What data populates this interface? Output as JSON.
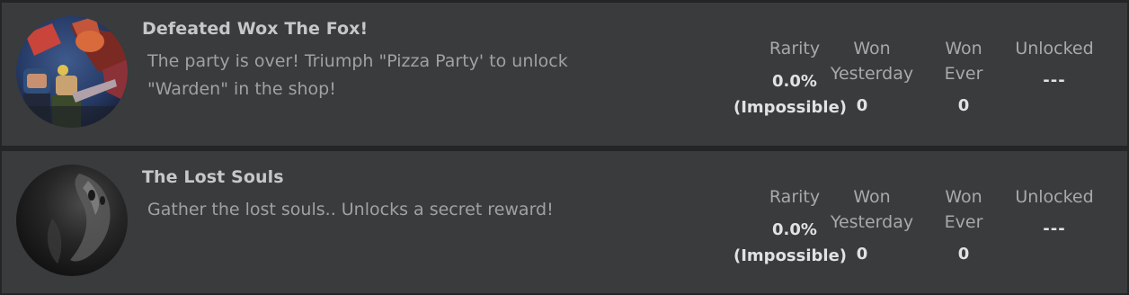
{
  "badges": [
    {
      "name": "Defeated Wox The Fox!",
      "description": "The party is over! Triumph \"Pizza Party' to unlock \"Warden\" in the shop!",
      "stats": {
        "rarity_label": "Rarity",
        "rarity_value": "0.0%",
        "rarity_note": "(Impossible)",
        "won_yesterday_label": "Won Yesterday",
        "won_yesterday_value": "0",
        "won_ever_label": "Won Ever",
        "won_ever_value": "0",
        "unlocked_label": "Unlocked",
        "unlocked_value": "---"
      },
      "icon": "badge-fox-artwork"
    },
    {
      "name": "The Lost Souls",
      "description": "Gather the lost souls.. Unlocks a secret reward!",
      "stats": {
        "rarity_label": "Rarity",
        "rarity_value": "0.0%",
        "rarity_note": "(Impossible)",
        "won_yesterday_label": "Won Yesterday",
        "won_yesterday_value": "0",
        "won_ever_label": "Won Ever",
        "won_ever_value": "0",
        "unlocked_label": "Unlocked",
        "unlocked_value": "---"
      },
      "icon": "badge-lost-souls-artwork"
    }
  ]
}
